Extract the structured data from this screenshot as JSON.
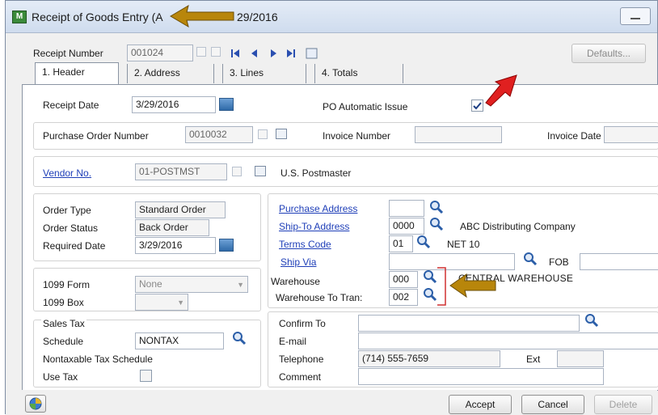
{
  "window": {
    "title": "Receipt of Goods Entry (A",
    "title_date": "29/2016"
  },
  "header": {
    "receipt_number_label": "Receipt Number",
    "receipt_number": "001024",
    "defaults_label": "Defaults..."
  },
  "tabs": [
    {
      "label": "1. Header"
    },
    {
      "label": "2. Address"
    },
    {
      "label": "3. Lines"
    },
    {
      "label": "4. Totals"
    }
  ],
  "form": {
    "receipt_date_label": "Receipt Date",
    "receipt_date": "3/29/2016",
    "po_auto_issue_label": "PO Automatic Issue",
    "po_auto_issue_checked": true,
    "po_number_label": "Purchase Order Number",
    "po_number": "0010032",
    "invoice_number_label": "Invoice Number",
    "invoice_number": "",
    "invoice_date_label": "Invoice Date",
    "invoice_date": "",
    "vendor_no_label": "Vendor No.",
    "vendor_no": "01-POSTMST",
    "vendor_name": "U.S. Postmaster",
    "order_type_label": "Order Type",
    "order_type": "Standard Order",
    "order_status_label": "Order Status",
    "order_status": "Back Order",
    "required_date_label": "Required Date",
    "required_date": "3/29/2016",
    "form1099_label": "1099 Form",
    "form1099": "None",
    "box1099_label": "1099 Box",
    "box1099": "",
    "sales_tax_label": "Sales Tax",
    "schedule_label": "Schedule",
    "schedule": "NONTAX",
    "nontax_label": "Nontaxable Tax Schedule",
    "use_tax_label": "Use Tax",
    "use_tax_checked": false,
    "purchase_address_label": "Purchase Address",
    "purchase_address": "",
    "ship_to_label": "Ship-To Address",
    "ship_to": "0000",
    "ship_to_name": "ABC Distributing Company",
    "terms_code_label": "Terms Code",
    "terms_code": "01",
    "terms_desc": "NET 10",
    "ship_via_label": "Ship Via",
    "ship_via": "",
    "fob_label": "FOB",
    "fob": "",
    "warehouse_label": "Warehouse",
    "warehouse": "000",
    "warehouse_name": "CENTRAL WAREHOUSE",
    "warehouse_trans_label": "Warehouse To Tran:",
    "warehouse_trans": "002",
    "confirm_to_label": "Confirm To",
    "confirm_to": "",
    "email_label": "E-mail",
    "email": "",
    "telephone_label": "Telephone",
    "telephone": "(714) 555-7659",
    "ext_label": "Ext",
    "ext": "",
    "comment_label": "Comment",
    "comment": ""
  },
  "footer": {
    "accept": "Accept",
    "cancel": "Cancel",
    "delete": "Delete"
  },
  "colors": {
    "annotation_arrow": "#b8860b",
    "red_arrow": "#e02020",
    "link": "#1f3fb8"
  }
}
